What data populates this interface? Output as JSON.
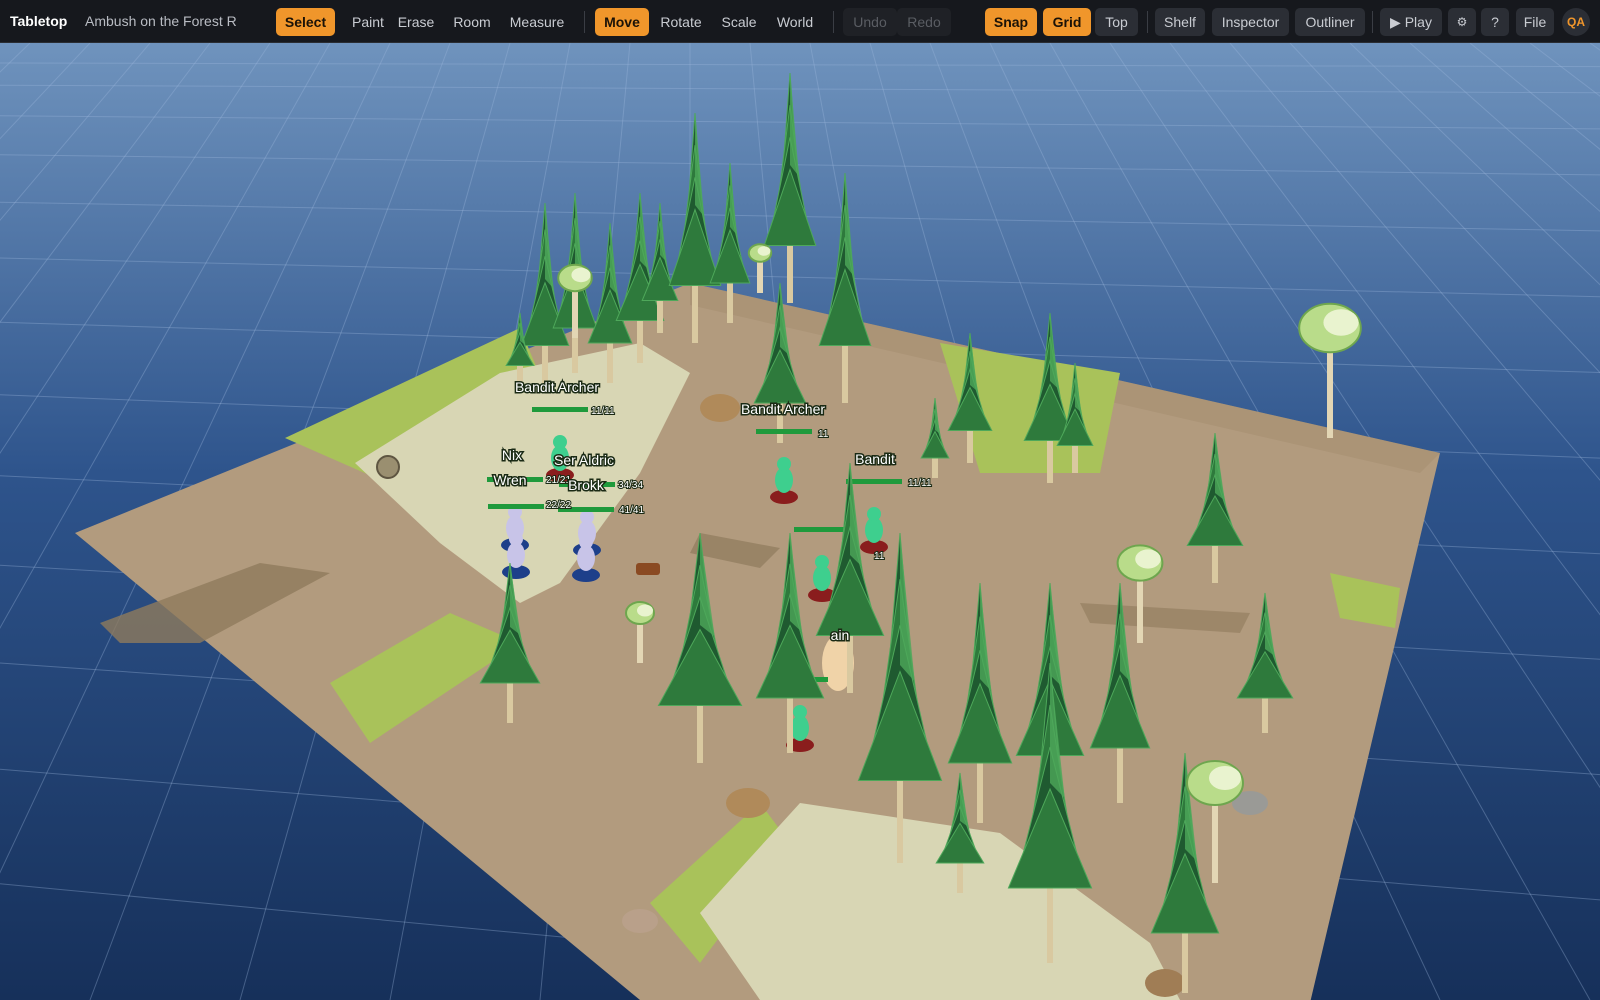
{
  "app": {
    "name": "Tabletop",
    "scene_title": "Ambush on the Forest R"
  },
  "toolbar": {
    "tools": [
      {
        "label": "Select",
        "active": true
      },
      {
        "label": "Paint",
        "active": false
      },
      {
        "label": "Erase",
        "active": false
      },
      {
        "label": "Room",
        "active": false
      },
      {
        "label": "Measure",
        "active": false
      }
    ],
    "transforms": [
      {
        "label": "Move",
        "active": true
      },
      {
        "label": "Rotate",
        "active": false
      },
      {
        "label": "Scale",
        "active": false
      },
      {
        "label": "World",
        "active": false
      }
    ],
    "history": {
      "undo": "Undo",
      "redo": "Redo"
    },
    "view": [
      {
        "label": "Snap",
        "active": true
      },
      {
        "label": "Grid",
        "active": true
      },
      {
        "label": "Top",
        "active": false
      }
    ],
    "panels": [
      "Shelf",
      "Inspector",
      "Outliner"
    ],
    "play": "▶ Play",
    "settings_glyph": "⚙",
    "help": "?",
    "file": "File",
    "user_initials": "QA"
  },
  "tokens": [
    {
      "name": "Bandit Archer",
      "hp": "11/11",
      "team": "enemy"
    },
    {
      "name": "Bandit Archer",
      "hp": "11",
      "team": "enemy"
    },
    {
      "name": "Bandit",
      "hp": "11/11",
      "team": "enemy"
    },
    {
      "name": "Nix",
      "hp": "21/21",
      "team": "party"
    },
    {
      "name": "Wren",
      "hp": "22/22",
      "team": "party"
    },
    {
      "name": "Ser Aldric",
      "hp": "34/34",
      "team": "party"
    },
    {
      "name": "Brokk",
      "hp": "41/41",
      "team": "party"
    },
    {
      "name": "",
      "hp": "11",
      "team": "enemy"
    },
    {
      "name": "ain",
      "hp": "",
      "team": "enemy"
    }
  ],
  "colors": {
    "accent": "#f0962b",
    "sky_top": "#6f93bd",
    "sky_bottom": "#16305a",
    "grass": "#a9c25a",
    "dirt": "#b29b7e",
    "path": "#d8d6b4",
    "pine_dark": "#1f5a30",
    "pine_light": "#4ea85a",
    "hp_bar": "#1f9a3c"
  }
}
